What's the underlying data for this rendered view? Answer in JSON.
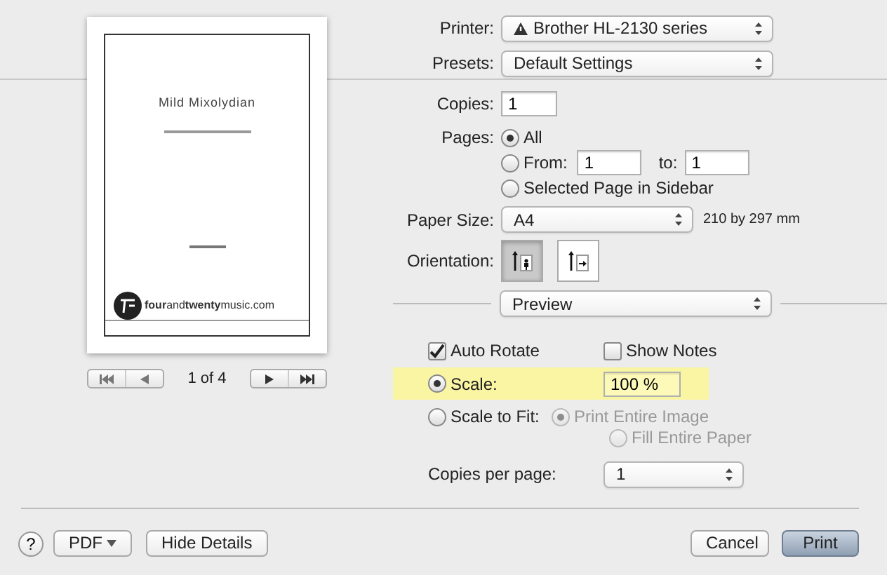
{
  "preview": {
    "title": "Mild Mixolydian",
    "publisher": "**four**and**twenty**music.com",
    "page_indicator": "1 of 4"
  },
  "printer": {
    "label": "Printer:",
    "value": "Brother HL-2130 series"
  },
  "presets": {
    "label": "Presets:",
    "value": "Default Settings"
  },
  "copies": {
    "label": "Copies:",
    "value": "1"
  },
  "pages": {
    "label": "Pages:",
    "options": [
      {
        "kind": "plain",
        "label": "All",
        "selected": true
      },
      {
        "kind": "range",
        "label": "From:",
        "value": "1",
        "to_label": "to:",
        "to_value": "1",
        "selected": false
      },
      {
        "kind": "plain",
        "label": "Selected Page in Sidebar",
        "selected": false
      }
    ]
  },
  "paper_size": {
    "label": "Paper Size:",
    "value": "A4",
    "dimensions": "210 by 297 mm"
  },
  "orientation": {
    "label": "Orientation:",
    "options": [
      {
        "kind": "portrait",
        "selected": true
      },
      {
        "kind": "landscape",
        "selected": false
      }
    ]
  },
  "section": {
    "value": "Preview"
  },
  "checkboxes": [
    {
      "label": "Auto Rotate",
      "checked": true
    },
    {
      "label": "Show Notes",
      "checked": false
    }
  ],
  "scale_modes": [
    {
      "kind": "scale",
      "label": "Scale:",
      "value": "100 %",
      "selected": true,
      "highlighted": true
    },
    {
      "kind": "fit",
      "label": "Scale to Fit:",
      "selected": false,
      "highlighted": false,
      "options": [
        {
          "label": "Print Entire Image",
          "selected": true,
          "disabled": true
        },
        {
          "label": "Fill Entire Paper",
          "selected": false,
          "disabled": true
        }
      ]
    }
  ],
  "copies_per_page": {
    "label": "Copies per page:",
    "value": "1"
  },
  "footer": {
    "help": "?",
    "pdf": "PDF",
    "hide_details": "Hide Details",
    "cancel": "Cancel",
    "print": "Print"
  }
}
